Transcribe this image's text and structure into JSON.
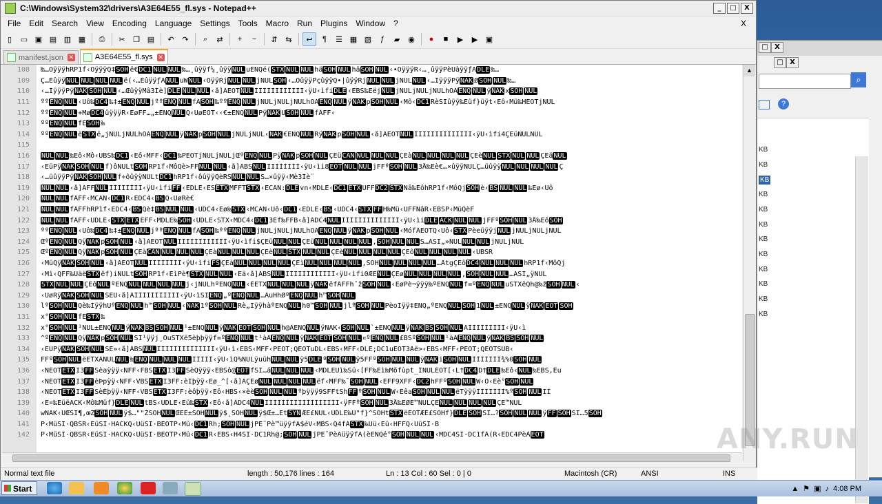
{
  "window": {
    "title": "C:\\Windows\\System32\\drivers\\A3E64E55_fl.sys - Notepad++",
    "minimize": "_",
    "maximize": "□",
    "close": "X"
  },
  "menu": [
    "File",
    "Edit",
    "Search",
    "View",
    "Encoding",
    "Language",
    "Settings",
    "Tools",
    "Macro",
    "Run",
    "Plugins",
    "Window",
    "?"
  ],
  "menu_close": "X",
  "toolbar_icons": [
    "new-file-icon",
    "open-file-icon",
    "save-icon",
    "save-all-icon",
    "close-icon",
    "close-all-icon",
    "print-icon",
    "cut-icon",
    "copy-icon",
    "paste-icon",
    "undo-icon",
    "redo-icon",
    "find-icon",
    "replace-icon",
    "zoom-in-icon",
    "zoom-out-icon",
    "sync-v-icon",
    "sync-h-icon",
    "wrap-icon",
    "all-chars-icon",
    "indent-guide-icon",
    "udl-icon",
    "doc-map-icon",
    "func-list-icon",
    "folder-icon",
    "monitor-icon",
    "record-icon",
    "stop-icon",
    "play-icon",
    "play-multi-icon",
    "save-macro-icon"
  ],
  "tabs": [
    {
      "label": "manifest.json",
      "active": false
    },
    {
      "label": "A3E64E55_fl.sys",
      "active": true
    }
  ],
  "editor": {
    "lines": [
      {
        "n": "108",
        "t": "‰…ÔÿÿÿhRP1f‹ ÔÿÿÿQ‡ SOH ë€ DC1 NUL NUL ‰…¸ûÿÿf¼¸ûÿÿ NUL uEN Qé( STX NUL NUL hä SOH NUL hä SOH NUL ‹•ÔÿÿÿR‹…¸ûÿÿPèÛàÿÿƒÄ DLE ‰…"
      },
      {
        "n": "109",
        "t": "Ç…Èûÿÿ NUL NUL NUL NUL ë(‹…Èûÿÿ ƒÀ NUL uW NUL ‹ÔÿÿRj NUL NUL jNUL SOH ‹…ÔûÿÿPç ûÿÿQ•|ûÿÿRj NUL NUL jNUL NUL ‹…ÎÿÿÿPÿ NAK Ø SOH NUL ‰…"
      },
      {
        "n": "110",
        "t": "‹…ÎÿÿÿPÿ NAK  SOH NUL ‹…Œûÿÿ Mâ3Íè] DLE NUL NUL ‹å] ÂEOT NUL ÌÌÌÌÌÌÌÌÌÌÌÌ‹ÿU‹ìfi DLE ‹ EBS ‰Eëj NUL jNUL jNUL jNUL hOÁ ENQ NUL ÿ NAK x SOH NUL"
      },
      {
        "n": "111",
        "t": "ºº ENQ NUL ‹ Uô‰ DC4 ‰‡± ENQ NUL j ºº ENQ NUL fÂ SOH ‰ºº ENQ NUL jNUL jNUL jNUL hOÁ ENQ NUL ÿ NAK p  SOH NUL ‹ Mô‹ DC1 RèSIûÿÿ‰Eüf}üÿt ‹Eô‹Mü‰HEOT jNUL"
      },
      {
        "n": "112",
        "t": "ºº ENQ NUL +Mø DC4 ûÿÿÿR‹ EøFF…„±ENQ NUL Q‹ UøEOT ‹‹€±ENQ NUL Pÿ NAK Ü  SOH NUL fÂFF‹"
      },
      {
        "n": "113",
        "t": "ºº ENQ NUL fÉ SOH ‰"
      },
      {
        "n": "114",
        "t": "ºº ENQ NUL ë STX ë„jNUL jNUL hOÁ ENQ NUL ÿ NAK p  SOH NUL jNUL jNUL ‹ NAK €ENQ NUL Rÿ NAK p  SOH NUL ‹å] ÂEOT NUL ÌÌÌÌÌÌÌÌÌÌÌÌÌÌ‹ÿU‹ìfi4ÇEüNULNUL"
      },
      {
        "n": "115",
        "t": ""
      },
      {
        "n": "116",
        "t": "NUL NUL ‰Eô‹ Mô‹ UBS ‰ DC1 ‹ Eô‹ MFF‹ DC1 ‰PEOT jNUL jNUL jŒº ENQ NUL Pÿ NAK p  SOH NUL ÇEü CAN NUL NUL NUL ÇEà NUL NUL NUL NUL ÇEè NUL STX NUL NUL ÇEä NUL"
      },
      {
        "n": "117",
        "t": "‹EüPÿ NAK  SOH NUL f)ôNULt SOH RP1f‹ MôQè>FF NUL NUL ‹å] ÂBS NUL ÌÌÌÌÌÌÌÌ‹ÿU‹ìi8 EOT NUL NUL jFFº SOH NUL 3Å‰Eè€…×ûÿÿNUL Ç…üûÿÿ NUL NUL NUL NUL Ç"
      },
      {
        "n": "118",
        "t": "‹…üûÿÿPÿ NAK  SOH NUL f÷ôûÿÿNULt DC1 hRP1f‹ ôûÿÿQèRS NUL NUL Š…×ûÿÿ‹Mè3Íè¨"
      },
      {
        "n": "119",
        "t": "NUL NUL ‹å] ÂFF NUL ÌÌÌÌÌÌÌÌ‹ÿU‹ìfi FF ‹ EDLE ‹ ES ETX MFFT  STX ‹ ECAN: DLE vn‹ MDLE ‹ DC1 ETX UFF DC2 STX Ñâ‰EôhRP1f‹ MôQj SOH è‹ BS NUL NUL ‰Eø‹ Uô"
      },
      {
        "n": "120",
        "t": "NUL NUL fÂFF‹ MCAN‹ DC1 R‹ EDC4‹ BS Q‹ UøRè€"
      },
      {
        "n": "121",
        "t": "NUL NUL fÂFF hRP1f‹ EDC4‹ BS Qè‡ BS NUL NUL ‹ UDC4‹ Eø‰ STX ‹ MCAN‹ Uô‹ DC1 ‹ EDLE ‹ BS ‹ UDC4‹ STX FF H‰Mü‹ UFF ÑâR‹ EBS P‹ MüQèF"
      },
      {
        "n": "122",
        "t": "NUL NUL fÂFF‹ UDLE‹ STX ETX EFF‹ MDLE‰ SOH ‹ UDLE‹ STX‹ MDC4‹ DC1 3Éf‰FF B‹å] ÂDC4 NUL ÌÌÌÌÌÌÌÌÌÌÌÌÌÌ‹ÿU‹ìi DLE ACK NUL NUL jFFº SOH NUL 3Å‰Eô SOH"
      },
      {
        "n": "123",
        "t": "ºº ENQ NUL ‹ Uô‰ DC4 ‰‡± ENQ NUL j ºº ENQ NUL fÂ SOH ‰ºº ENQ NUL jNUL jNUL jNUL hOÁ ENQ NUL ÿ NAK p  SOH NUL ‹ MófÂEOT Q‹ Uô‹ STX Pèeüÿÿj NUL jNUL jNUL jNUL"
      },
      {
        "n": "124",
        "t": "Œº ENQ NUL Qÿ NAK p  SOH NUL ‹å] ÂEOT NUL ÌÌÌÌÌÌÌÌÌÌÌÌ‹ÿU‹ìfi$ÇEü NUL NUL ÇEü NUL NUL NUL NUL , SOH NUL NUL Š…ÀSI„»NUL NUL NUL jNUL jNUL"
      },
      {
        "n": "125",
        "t": "Œº ENQ NUL Qÿ NAK p  SOH NUL ÇEà CAN NUL NUL NUL ÇEà NUL NUL NUL ÇEè NUL STX NUL NUL ÇEè NUL NUL NUL NUL ÇEô NUL NUL NUL NUL ‹ UBSR"
      },
      {
        "n": "126",
        "t": "‹ MüQÿ NAK  SOH NUL ‹å] ÂEOT NUL ÌÌÌÌÌÌÌÌ‹ÿU‹ìfi FS ÇEà NUL NUL NUL NUL ÇEì NUL NUL NUL NUL ,SOH NUL NUL NUL NUL …Àtg ÇEô DC4 NUL NUL NUL hRP1f‹ MôQj"
      },
      {
        "n": "127",
        "t": "‹ Mì‹ QFF‰Uäë STX ëf) iNULt SOH RP1f‹ EìPè¶ STX NUL NUL ‹ Eä‹å] ÂBS NUL ÌÌÌÌÌÌÌÌÌÌÌÌ‹ÿU‹ìfi0ÆE NUL ÇEø NUL NUL NUL NUL , SOH NUL NUL …ÀSI„ÿNUL"
      },
      {
        "n": "128",
        "t": "STX NUL NUL ÇEô NUL ºENQ NUL NUL NUL NUL j‹ jNUL hºENQ NUL ‹ÈETX NUL NUL NUL ÿ NAK ê fÂFF h¨ž SOH NUL ‹ EøPè¬ÿÿÿ‰ºENQ NUL f=º ENQ NUL uSTX ëQh@‰ž SOH NUL ‹"
      },
      {
        "n": "129",
        "t": "‹ UøRÿ NAK  SOH NUL ŠEÜ‹å] ÂÌÌÌÌÌÌÌÌÌÌÌ‹ÿU‹ìSI ENQ „º ENQ NUL …ÀuHhØº ENQ NUL h™ SOH NUL"
      },
      {
        "n": "130",
        "t": "lº SOH NUL Qè‰ÌÿÿhÜº ENQ NUL h™ SOH NUL ‹ NAK 1º SOH NUL Rè„ÌÿÿhàºENQ NUL h0™ SOH NUL jlº SOH NUL PèoÌÿÿ‡ ENQ„ºENQ NUL SOH 1 NUL ±ENQ NUL ÿ NAK EOT SOH"
      },
      {
        "n": "131",
        "t": "x° SOH NUL fÉ STX ‰"
      },
      {
        "n": "132",
        "t": "x° SOH NUL ¹NUL ±ENQ NUL ÿ NAK BS  SOH NUL ¹ ±ENQ NUL ÿ NAK EOT  SOH NUL h@ÂENQ NUL ÿ NAK‹  SOH NUL ` ±ENQ NUL ÿ NAK BS  SOH NUL ÃÌÌÌÌÌÌÌÌÌ‹ÿU‹ì"
      },
      {
        "n": "133",
        "t": "^º ENQ NUL Qÿ NAK p  SOH NUL SÌ¹ÿÿj¸ÔuSTX ë5èþþÿÿf=º ENQ NUL t ¹àÂ ENQ NUL ÿ NAK EOT  SOH NUL ¤º ENQ NUL £BSº SOH NUL ¹àÂ ENQ NUL ÿ NAK BS  SOH NUL"
      },
      {
        "n": "134",
        "t": "‹ EÜPÿ NAK  SOH NUL Š E»‹å] ÂBS NUL ÌÌÌÌÌÌÌÌÌÌÌÌÌÌ‹ÿU‹ì‹ EBS‹ MFF‹ PEOT;QEOT uDL‹ EBS‹ MFF‹ DLE;DC1 uEOT 3Àë>‹ EBS‹ MFF‹ PEOT;QEOT SUB‹"
      },
      {
        "n": "135",
        "t": "FFº SOH NUL ëETX ÂNUL NUL ‰ ENQ NUL NUL NUL ÌÌÌÌÌ‹ÿU‹ìQ%NUL ÿuüh NUL NUL ÿ5 DLE º SOH NUL ÿ5FFº SOH NUL NUL ÿ NAK i  SOH NUL ÌÌÌÌÌÌÌ¾%0  SOH NUL"
      },
      {
        "n": "136",
        "t": "‹NEOT ETX I3 FF Sèaÿÿÿ‹ NFF‹ FBS ETX I3 FF SèQÿÿÿ‹ EBS ô@ EOT fSI…á NUL NUL NUL ‹ MDLE Uì‰Sü‹ [FF‰Eì‰ Mõfùpt_ INUL EOT[‹ L† DC4 D† DLE ‰Eô‹ NUL ‰ EBS ‚Éu"
      },
      {
        "n": "137",
        "t": "‹NEOT ETX I3 FF èÞpÿÿ‹ NFF‹ VBS ETX I3 FF:èÏþÿÿ‹ Eø_^[‹å] ÃÇEø NUL NUL NUL NUL ëf‹ MFF‰¯ SOH NUL ‹ EFF 9XFF‹ DC2 hFFº SOH NUL W‹ Ô‹ Èè° SOH NUL"
      },
      {
        "n": "138",
        "t": "‹NEOT ETX I3 FF SèÊþÿÿ‹ NFF‹ VBS ETX I3 FF:èôþÿÿ‹ Eô‹ HBS‹ ×èè SOH NUL NUL ºþÿÿÿ9SFF tŠh FF º SOH NUL W‹ Èêa SOH NUL NUL ëTÿÿÿÌÌÌÌÌÌÌ%º  SOH NUL ÌÌ"
      },
      {
        "n": "139",
        "t": "‹ E¤‰Eüë ACK‹ Mô‰Müf} DLE NUL tBS‹ UDLE‹ Eü‰ STX ‹ Eô‹å] ÂDC4 NUL ÌÌÌÌÌÌÌÌÌÌÌÌÌÌÌÌÌÌ‹ÿ FFº SOH NUL 3Å‰EØE™NUL ÇE NUL NUL NUL NUL ÇE™NUL"
      },
      {
        "n": "140",
        "t": "wNAK‹ UŒSI¶,œŽ SOH NUL ÿ$…\"\"ŽSOH NUL ŒEE±SOH NUL ÿ$¸SOH NUL ÿ$Œ±…Et SYN ÆE£NUL‹ UDLE ‰U\"f}^ SOHt STX ëEOT ÆE£SOH f} DLE SOH SI…? SOH NUL NUL ÿ FF SOH SI…5 SOH"
      },
      {
        "n": "141",
        "t": "P‹ MüSI ·QBS R‹ EüSI ·HACK Q‹ UüSI ·BEOT P‹ Mü‹ DC1 Rh; SOH NUL jPE¨Pè™üÿÿfÄ$éV‹ MBS‹ Q4 fÁ STX ‰Uü‹ Eü‹ HFF Q‹ UüSI ·B"
      },
      {
        "n": "142",
        "t": "P‹ MüSI ·QBS R‹ EüSI ·HACK Q‹ UüSI ·BEOT P‹ Mü‹ DC1 R‹ EBS‹ H4 SI·DC1 Rh@; SOH NUL jPE¨PèÄüÿÿfÄ(èENQ é° SOH NUL NUL ‹ MDC4 SI·DC1 fÂ(R‹ EDC4 PèÀ EOT"
      }
    ]
  },
  "status": {
    "file_type": "Normal text file",
    "length_lines": "length : 50,176    lines : 164",
    "position": "Ln : 13    Col : 60    Sel : 0 | 0",
    "eol": "Macintosh (CR)",
    "encoding": "ANSI",
    "mode": "INS"
  },
  "bg_window": {
    "kb_label": "KB",
    "kb_rows": 12
  },
  "taskbar": {
    "start_label": "Start",
    "clock": "4:08 PM"
  },
  "watermark": "ANY.RUN"
}
